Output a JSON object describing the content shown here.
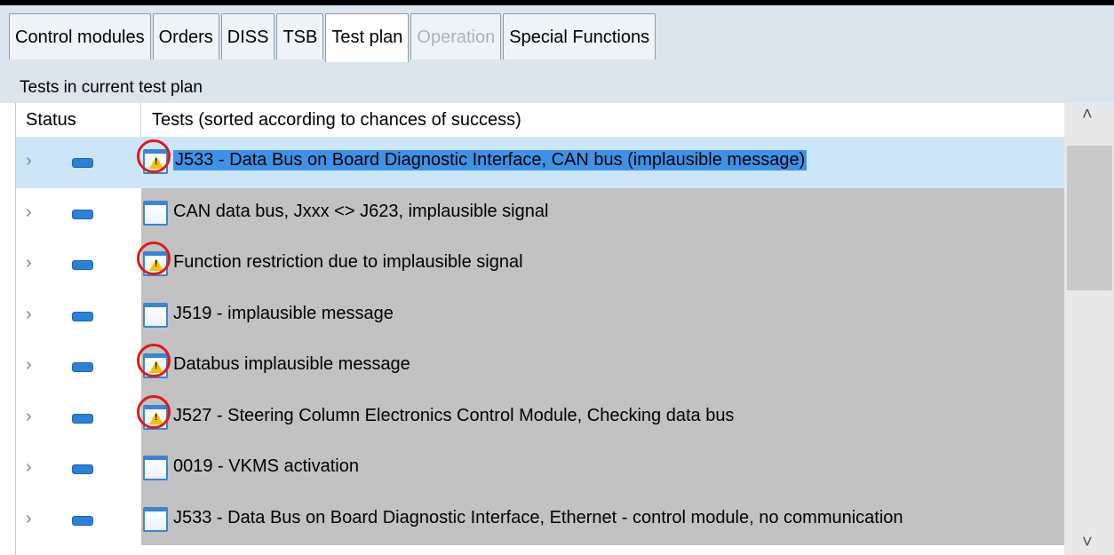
{
  "tabs": [
    {
      "label": "Control modules",
      "state": "normal"
    },
    {
      "label": "Orders",
      "state": "normal"
    },
    {
      "label": "DISS",
      "state": "normal"
    },
    {
      "label": "TSB",
      "state": "normal"
    },
    {
      "label": "Test plan",
      "state": "active"
    },
    {
      "label": "Operation",
      "state": "disabled"
    },
    {
      "label": "Special Functions",
      "state": "normal"
    }
  ],
  "section_label": "Tests in current test plan",
  "grid": {
    "col_status": "Status",
    "col_tests": "Tests (sorted according to chances of success)"
  },
  "rows": [
    {
      "text": "J533 - Data Bus on Board Diagnostic Interface, CAN bus (implausible message)",
      "warning": true,
      "circled": true,
      "selected": true
    },
    {
      "text": "CAN data bus, Jxxx <> J623, implausible signal",
      "warning": false,
      "circled": false,
      "selected": false
    },
    {
      "text": "Function restriction due to implausible signal",
      "warning": true,
      "circled": true,
      "selected": false
    },
    {
      "text": "J519 - implausible message",
      "warning": false,
      "circled": false,
      "selected": false
    },
    {
      "text": "Databus implausible message",
      "warning": true,
      "circled": true,
      "selected": false
    },
    {
      "text": "J527 - Steering Column Electronics Control Module, Checking data bus",
      "warning": true,
      "circled": true,
      "selected": false
    },
    {
      "text": "0019 - VKMS activation",
      "warning": false,
      "circled": false,
      "selected": false
    },
    {
      "text": "J533 - Data Bus on Board Diagnostic Interface, Ethernet - control module, no communication",
      "warning": false,
      "circled": false,
      "selected": false
    }
  ],
  "icons": {
    "expand": "chevron-right-icon",
    "status": "status-indicator-icon",
    "test": "document-icon",
    "warning": "warning-icon",
    "scroll_up": "chevron-up-icon",
    "scroll_down": "chevron-down-icon"
  },
  "colors": {
    "selected_row": "#cde6f7",
    "selected_text_highlight": "#3d92e8",
    "status_indicator": "#2a82d8",
    "annotation_circle": "#e01818",
    "row_background": "#c2c2c2"
  }
}
